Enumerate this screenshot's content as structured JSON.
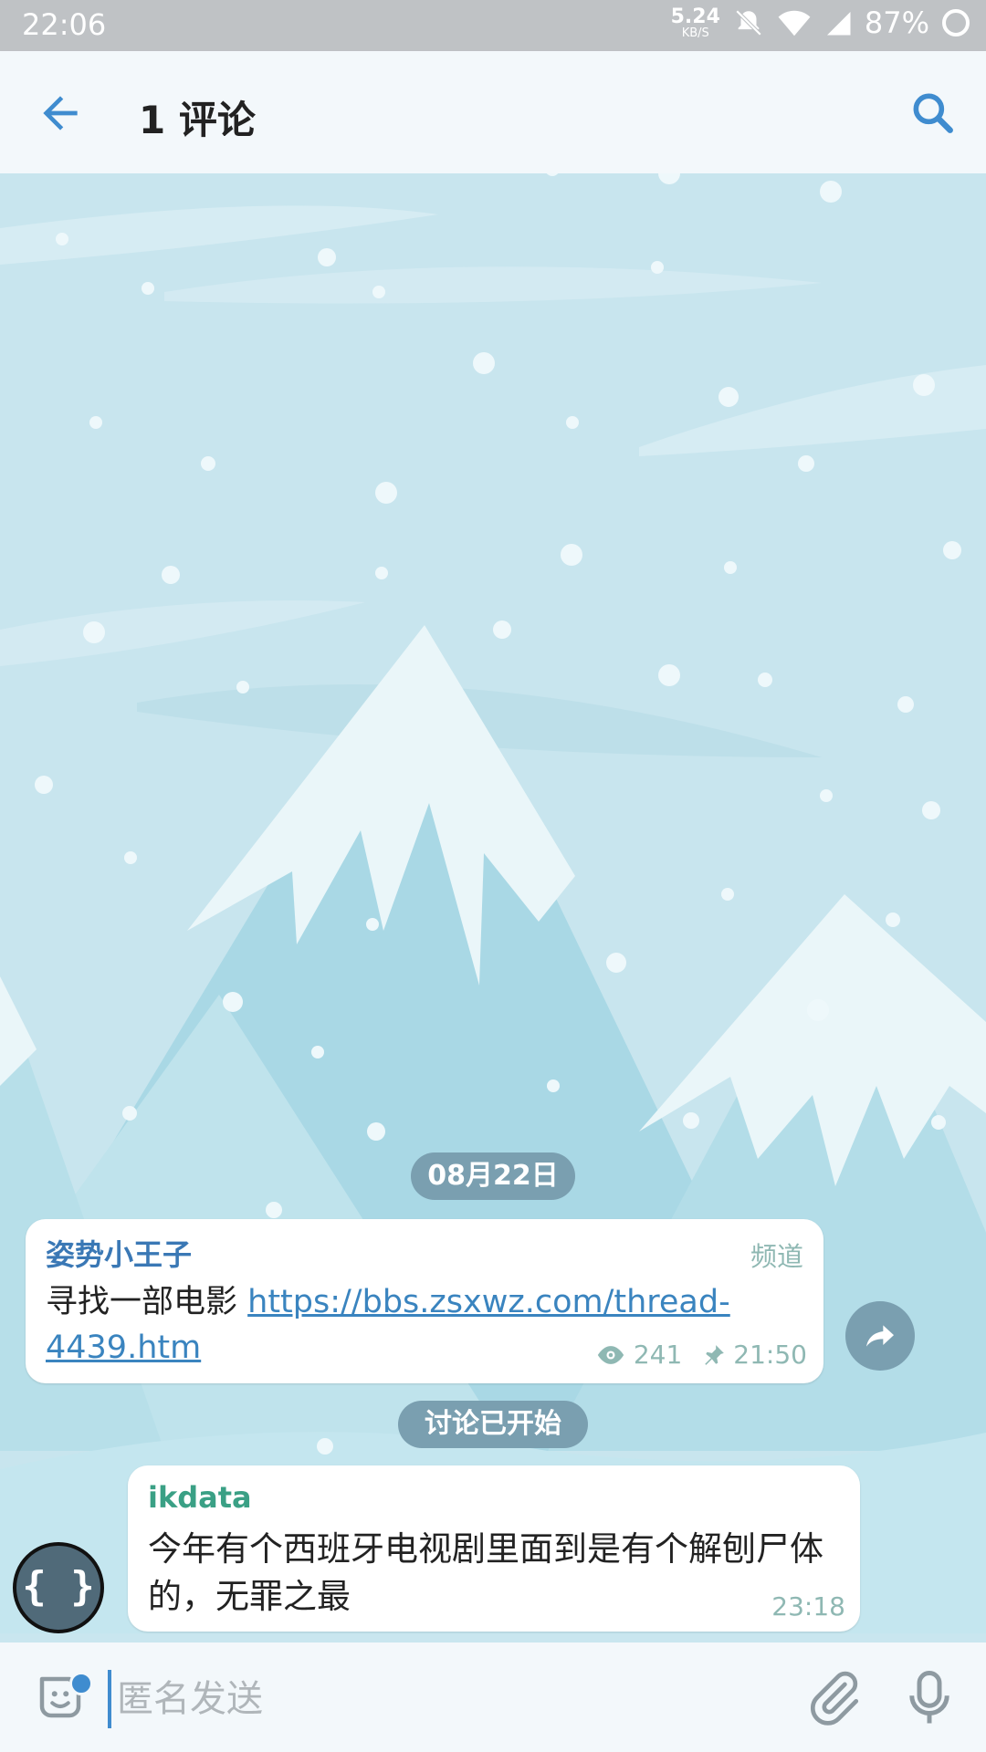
{
  "status_bar": {
    "time": "22:06",
    "net_speed": "5.24",
    "net_unit": "KB/S",
    "battery": "87%"
  },
  "header": {
    "title": "1 评论",
    "back_icon": "arrow-left-icon",
    "search_icon": "search-icon"
  },
  "chat": {
    "date_chip": "08月22日",
    "discussion_chip": "讨论已开始",
    "messages": [
      {
        "sender": "姿势小王子",
        "tag": "频道",
        "text": "寻找一部电影 ",
        "link": "https://bbs.zsxwz.com/thread-4439.htm",
        "views": "241",
        "time": "21:50"
      },
      {
        "sender": "ikdata",
        "text": "今年有个西班牙电视剧里面到是有个解刨尸体的，无罪之最",
        "time": "23:18",
        "avatar": "{ }"
      }
    ]
  },
  "input_bar": {
    "placeholder": "匿名发送"
  },
  "colors": {
    "accent": "#3f8ccf",
    "chip": "#7a9fb0",
    "header_bg": "#f3f8fb"
  }
}
